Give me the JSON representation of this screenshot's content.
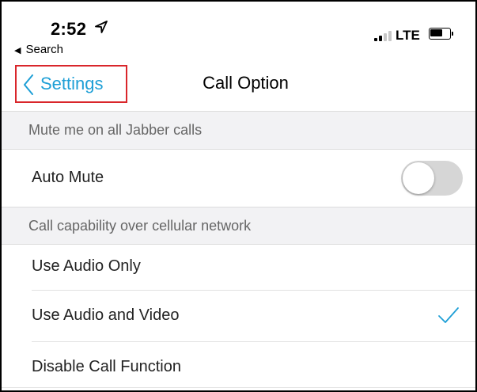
{
  "status_bar": {
    "time": "2:52",
    "back_app_label": "Search",
    "network": "LTE",
    "battery_level": 0.7
  },
  "nav": {
    "back_label": "Settings",
    "title": "Call Option"
  },
  "sections": [
    {
      "header": "Mute me on all Jabber calls",
      "rows": [
        {
          "label": "Auto Mute",
          "toggle_on": false
        }
      ]
    },
    {
      "header": "Call capability over cellular network",
      "rows": [
        {
          "label": "Use Audio Only",
          "selected": false
        },
        {
          "label": "Use Audio and Video",
          "selected": true
        },
        {
          "label": "Disable Call Function",
          "selected": false
        }
      ]
    }
  ],
  "colors": {
    "accent": "#1e9fd6",
    "highlight_border": "#d9262b",
    "section_bg": "#f2f2f4",
    "toggle_off": "#d6d6d6"
  },
  "icons": {
    "location": "location-arrow-icon",
    "back": "chevron-left-icon",
    "check": "checkmark-icon"
  }
}
